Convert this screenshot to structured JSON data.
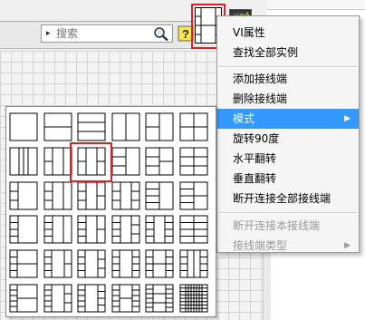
{
  "search": {
    "placeholder": "搜索",
    "arrow": "▸"
  },
  "help": {
    "label": "?"
  },
  "vi_icon": {
    "label": "VI"
  },
  "context_menu": {
    "items": [
      {
        "label": "VI属性",
        "enabled": true
      },
      {
        "label": "查找全部实例",
        "enabled": true
      },
      {
        "label": "添加接线端",
        "enabled": true
      },
      {
        "label": "删除接线端",
        "enabled": true
      },
      {
        "label": "模式",
        "enabled": true,
        "highlighted": true,
        "submenu": true
      },
      {
        "label": "旋转90度",
        "enabled": true
      },
      {
        "label": "水平翻转",
        "enabled": true
      },
      {
        "label": "垂直翻转",
        "enabled": true
      },
      {
        "label": "断开连接全部接线端",
        "enabled": true
      },
      {
        "label": "断开连接本接线端",
        "enabled": false
      },
      {
        "label": "接线端类型",
        "enabled": false,
        "submenu": true
      }
    ],
    "submenu_arrow": "▶"
  },
  "connector_patterns": {
    "rows": 6,
    "cols": 6,
    "selected": [
      1,
      2
    ]
  },
  "colors": {
    "highlight": "#3399ff",
    "selection_box": "#e02020"
  }
}
